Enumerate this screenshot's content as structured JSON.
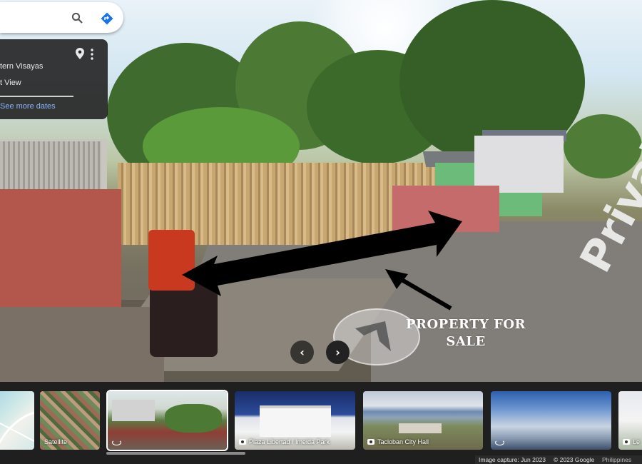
{
  "search": {
    "placeholder": ""
  },
  "info_card": {
    "region": "tern Visayas",
    "type": "t View",
    "see_more": "See more dates"
  },
  "scene": {
    "road_marking": "Private Rd",
    "annotation": "PROPERTY FOR SALE",
    "nav_prev": "‹",
    "nav_next": "›"
  },
  "strip": {
    "thumbnails": [
      {
        "label": "",
        "kind": "map"
      },
      {
        "label": "Satellite",
        "kind": "satellite"
      },
      {
        "label": "",
        "kind": "streetview",
        "selected": true
      },
      {
        "label": "Plaza Libertad / Imelda Park",
        "kind": "photo"
      },
      {
        "label": "Tacloban City Hall",
        "kind": "photo"
      },
      {
        "label": "",
        "kind": "streetview"
      },
      {
        "label": "Le",
        "kind": "photo"
      }
    ]
  },
  "footer": {
    "capture": "Image capture: Jun 2023",
    "copyright": "© 2023 Google",
    "country": "Philippines"
  },
  "colors": {
    "link": "#8ab4f8",
    "directions": "#1a73e8",
    "card_bg": "#222222"
  }
}
